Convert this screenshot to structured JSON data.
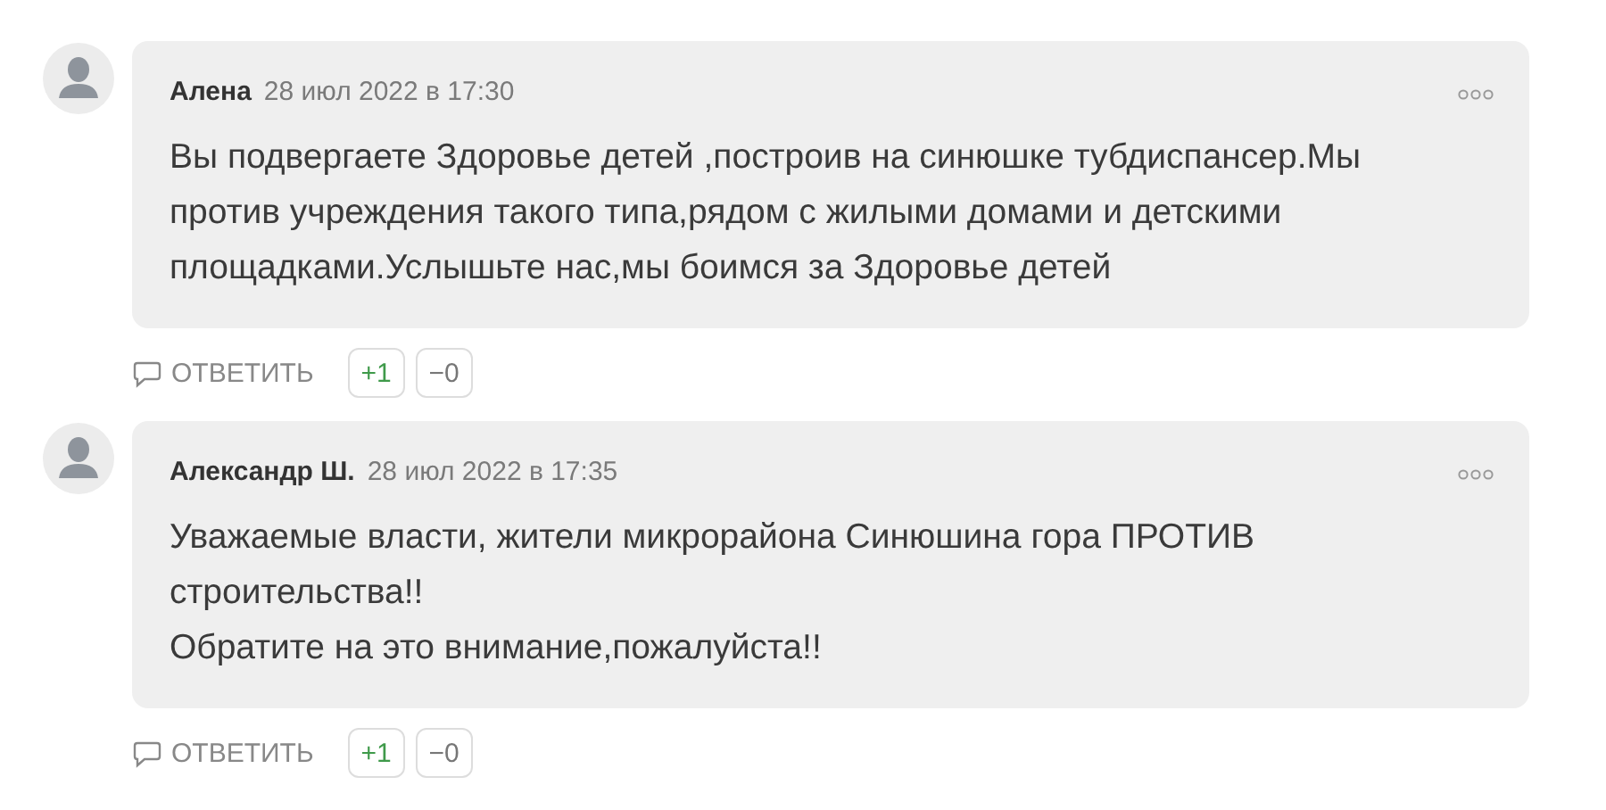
{
  "comments": [
    {
      "author": "Алена",
      "date": "28 июл 2022 в 17:30",
      "text": "Вы подвергаете Здоровье детей ,построив на синюшке тубдиспансер.Мы против учреждения такого типа,рядом с жилыми домами и детскими площадками.Услышьте нас,мы боимся за Здоровье детей",
      "reply": "ОТВЕТИТЬ",
      "upvotes": "+1",
      "downvotes": "−0"
    },
    {
      "author": "Александр Ш.",
      "date": "28 июл 2022 в 17:35",
      "text": "Уважаемые власти, жители микрорайона Синюшина гора ПРОТИВ строительства!!\nОбратите на это внимание,пожалуйста!!",
      "reply": "ОТВЕТИТЬ",
      "upvotes": "+1",
      "downvotes": "−0"
    }
  ]
}
